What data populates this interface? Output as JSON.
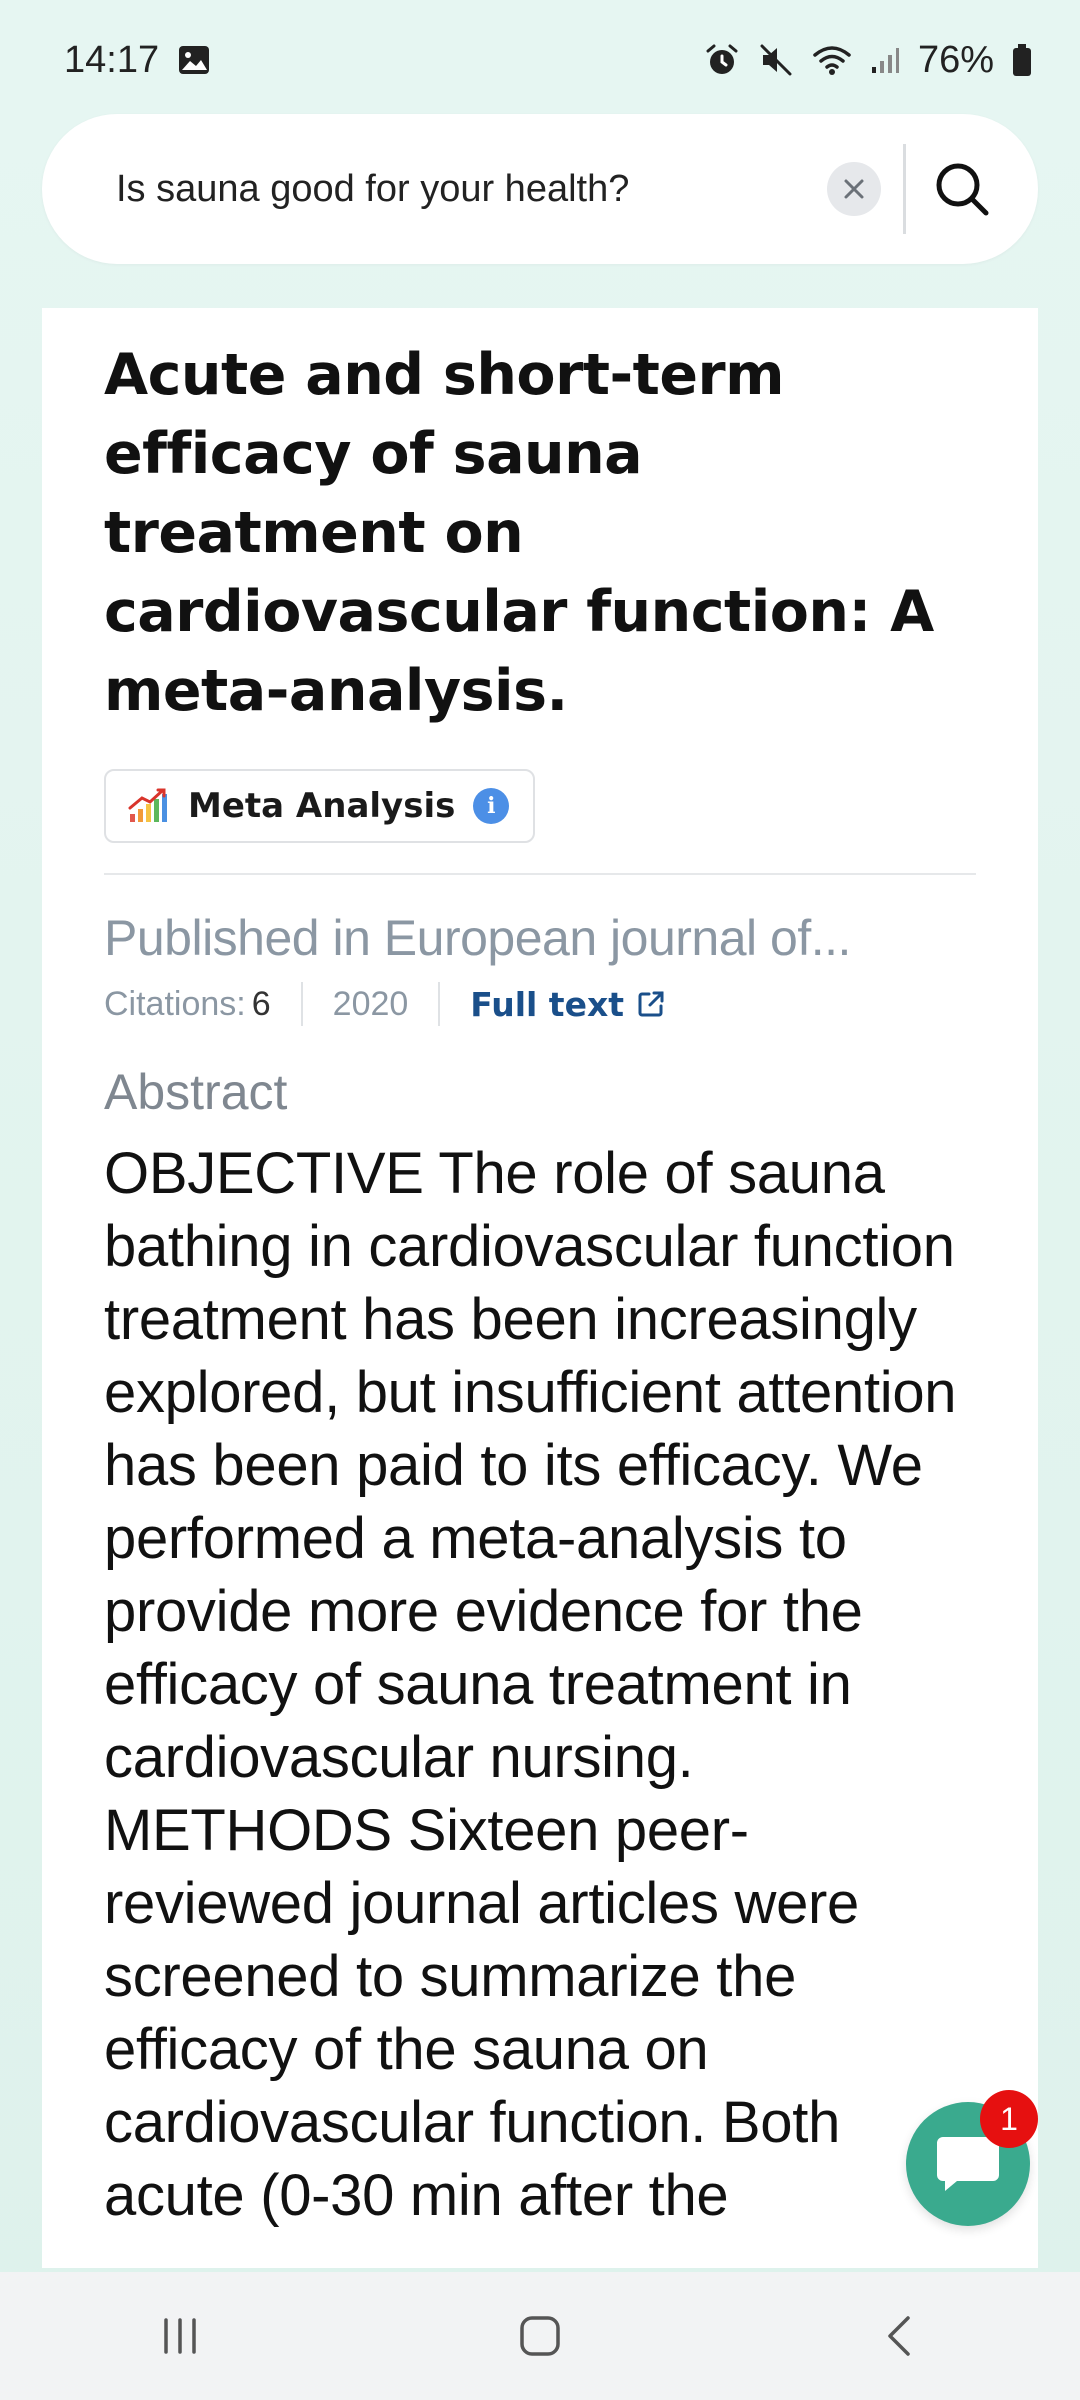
{
  "status_bar": {
    "time": "14:17",
    "battery": "76%",
    "icons": [
      "gallery-icon",
      "alarm-icon",
      "mute-icon",
      "wifi-icon",
      "signal-icon",
      "battery-icon"
    ]
  },
  "search": {
    "value": "Is sauna good for your health?"
  },
  "paper": {
    "title": "Acute and short-term efficacy of sauna treatment on cardiovascular function: A meta-analysis.",
    "badge_label": "Meta Analysis",
    "published_in": "Published in European journal of...",
    "citations_label": "Citations:",
    "citations_value": "6",
    "year": "2020",
    "full_text_label": "Full text",
    "abstract_heading": "Abstract",
    "abstract_text": "OBJECTIVE The role of sauna bathing in cardiovascular function treatment has been increasingly explored, but insufficient attention has been paid to its efficacy. We performed a meta-analysis to provide more evidence for the efficacy of sauna treatment in cardiovascular nursing. METHODS Sixteen peer-reviewed journal articles were screened to summarize the efficacy of the sauna on cardiovascular function. Both acute (0-30 min after the"
  },
  "chat": {
    "unread_count": "1"
  },
  "colors": {
    "accent_green": "#3aaa8e",
    "link_blue": "#1a4f8a",
    "info_blue": "#4c8fe6",
    "badge_red": "#e61010",
    "muted_text": "#8b97a3"
  }
}
